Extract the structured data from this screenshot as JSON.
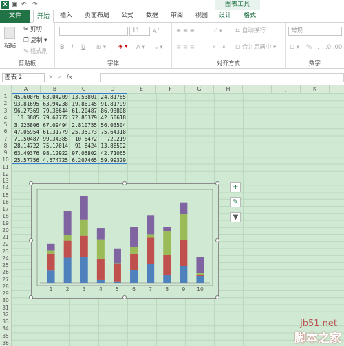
{
  "title_bar": {
    "chart_tools": "图表工具",
    "undo": "↶",
    "redo": "↷"
  },
  "tabs": [
    "文件",
    "开始",
    "插入",
    "页面布局",
    "公式",
    "数据",
    "审阅",
    "视图",
    "设计",
    "格式"
  ],
  "ribbon": {
    "clipboard": {
      "paste": "粘贴",
      "cut": "剪切",
      "copy": "复制",
      "format_painter": "格式刷",
      "label": "剪贴板"
    },
    "font": {
      "size": "11",
      "label": "字体",
      "bold": "B",
      "italic": "I",
      "underline": "U"
    },
    "alignment": {
      "wrap": "自动换行",
      "merge": "合并后居中",
      "label": "对齐方式"
    },
    "number": {
      "format": "常规",
      "label": "数字",
      "percent": "%"
    }
  },
  "formula_bar": {
    "name_box": "图表 2",
    "fx": "fx",
    "content": ""
  },
  "columns": [
    "A",
    "B",
    "C",
    "D",
    "E",
    "F",
    "G",
    "H",
    "I",
    "J",
    "K"
  ],
  "rows": [
    "1",
    "2",
    "3",
    "4",
    "5",
    "6",
    "7",
    "8",
    "9",
    "10",
    "11",
    "12",
    "13",
    "14",
    "15",
    "16",
    "17",
    "18",
    "19",
    "20",
    "21",
    "22",
    "23",
    "24",
    "25",
    "26",
    "27",
    "28",
    "29",
    "30",
    "31",
    "32",
    "33",
    "34",
    "35",
    "36"
  ],
  "cells": [
    [
      "45.60076",
      "63.04209",
      "13.53801",
      "24.81765"
    ],
    [
      "93.81695",
      "63.94238",
      "19.86145",
      "91.81799"
    ],
    [
      "96.27369",
      "79.36644",
      "61.20487",
      "86.93808"
    ],
    [
      "10.3885",
      "79.67772",
      "72.85379",
      "42.50618"
    ],
    [
      "3.225806",
      "67.09494",
      "2.810755",
      "56.03504"
    ],
    [
      "47.05954",
      "61.31779",
      "25.35173",
      "75.64318"
    ],
    [
      "71.50487",
      "99.34385",
      "10.5472",
      "72.219"
    ],
    [
      "28.14722",
      "75.17014",
      "91.8424",
      "13.88592"
    ],
    [
      "63.49376",
      "98.12922",
      "97.05802",
      "42.71065"
    ],
    [
      "25.57756",
      "4.574725",
      "6.207465",
      "59.99329"
    ]
  ],
  "colors": {
    "s1": "#4f81bd",
    "s2": "#c0504d",
    "s3": "#9bbb59",
    "s4": "#8064a2",
    "brand": "#217346"
  },
  "chart_data": {
    "type": "bar",
    "stacked": true,
    "categories": [
      "1",
      "2",
      "3",
      "4",
      "5",
      "6",
      "7",
      "8",
      "9",
      "10"
    ],
    "series": [
      {
        "values": [
          45.60076,
          93.81695,
          96.27369,
          10.3885,
          3.225806,
          47.05954,
          71.50487,
          28.14722,
          63.49376,
          25.57756
        ]
      },
      {
        "values": [
          63.04209,
          63.94238,
          79.36644,
          79.67772,
          67.09494,
          61.31779,
          99.34385,
          75.17014,
          98.12922,
          4.574725
        ]
      },
      {
        "values": [
          13.53801,
          19.86145,
          61.20487,
          72.85379,
          2.810755,
          25.35173,
          10.5472,
          91.8424,
          97.05802,
          6.207465
        ]
      },
      {
        "values": [
          24.81765,
          91.81799,
          86.93808,
          42.50618,
          56.03504,
          75.64318,
          72.219,
          13.88592,
          42.71065,
          59.99329
        ]
      }
    ],
    "xlabel": "",
    "ylabel": "",
    "legend": "none",
    "grid": false
  },
  "watermark": {
    "line1": "jb51.net",
    "line2": "脚本之家"
  }
}
